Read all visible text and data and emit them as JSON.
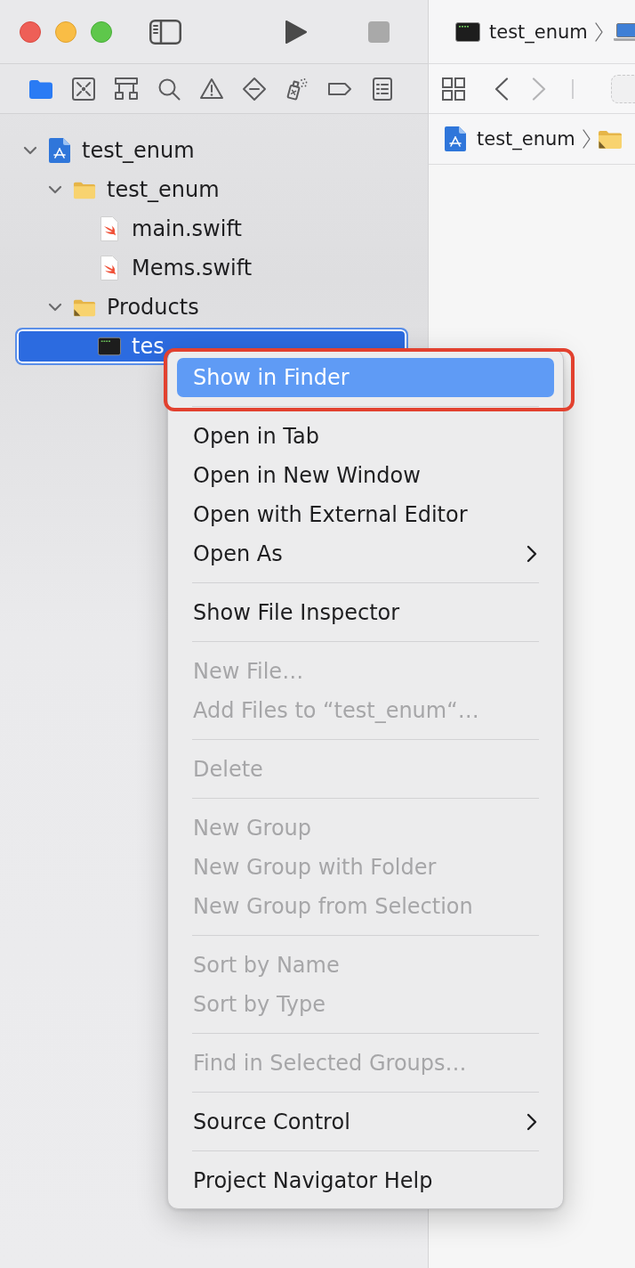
{
  "toolbar": {
    "run_buttons": [
      {
        "kind": "run",
        "disabled": false
      },
      {
        "kind": "stop",
        "disabled": true
      }
    ],
    "scheme": "test_enum"
  },
  "navigator_tabs": [
    {
      "kind": "project",
      "selected": true
    },
    {
      "kind": "source_control",
      "selected": false
    },
    {
      "kind": "symbol",
      "selected": false
    },
    {
      "kind": "find",
      "selected": false
    },
    {
      "kind": "issue",
      "selected": false
    },
    {
      "kind": "test",
      "selected": false
    },
    {
      "kind": "debug",
      "selected": false
    },
    {
      "kind": "breakpoint",
      "selected": false
    },
    {
      "kind": "report",
      "selected": false
    }
  ],
  "editor_nav": {
    "buttons": [
      {
        "kind": "grid"
      },
      {
        "kind": "back",
        "disabled": false
      },
      {
        "kind": "forward",
        "disabled": true
      }
    ]
  },
  "jump_bar": [
    {
      "kind": "project",
      "label": "test_enum"
    },
    {
      "kind": "products_folder"
    }
  ],
  "tree": [
    {
      "kind": "project",
      "label": "test_enum",
      "expanded": true,
      "selected": false,
      "children": [
        {
          "kind": "folder",
          "label": "test_enum",
          "expanded": true,
          "selected": false,
          "children": [
            {
              "kind": "swift",
              "label": "main.swift",
              "selected": false
            },
            {
              "kind": "swift",
              "label": "Mems.swift",
              "selected": false
            }
          ]
        },
        {
          "kind": "products_folder",
          "label": "Products",
          "expanded": true,
          "selected": false,
          "children": [
            {
              "kind": "executable",
              "label": "tes",
              "selected": true
            }
          ]
        }
      ]
    }
  ],
  "context_menu": {
    "sections": [
      {
        "items": [
          {
            "label": "Show in Finder",
            "selected": true,
            "disabled": false,
            "submenu": false,
            "outlined": true
          }
        ]
      },
      {
        "items": [
          {
            "label": "Open in Tab",
            "selected": false,
            "disabled": false,
            "submenu": false,
            "outlined": false
          },
          {
            "label": "Open in New Window",
            "selected": false,
            "disabled": false,
            "submenu": false,
            "outlined": false
          },
          {
            "label": "Open with External Editor",
            "selected": false,
            "disabled": false,
            "submenu": false,
            "outlined": false
          },
          {
            "label": "Open As",
            "selected": false,
            "disabled": false,
            "submenu": true,
            "outlined": false
          }
        ]
      },
      {
        "items": [
          {
            "label": "Show File Inspector",
            "selected": false,
            "disabled": false,
            "submenu": false,
            "outlined": false
          }
        ]
      },
      {
        "items": [
          {
            "label": "New File…",
            "selected": false,
            "disabled": true,
            "submenu": false,
            "outlined": false
          },
          {
            "label": "Add Files to “test_enum“…",
            "selected": false,
            "disabled": true,
            "submenu": false,
            "outlined": false
          }
        ]
      },
      {
        "items": [
          {
            "label": "Delete",
            "selected": false,
            "disabled": true,
            "submenu": false,
            "outlined": false
          }
        ]
      },
      {
        "items": [
          {
            "label": "New Group",
            "selected": false,
            "disabled": true,
            "submenu": false,
            "outlined": false
          },
          {
            "label": "New Group with Folder",
            "selected": false,
            "disabled": true,
            "submenu": false,
            "outlined": false
          },
          {
            "label": "New Group from Selection",
            "selected": false,
            "disabled": true,
            "submenu": false,
            "outlined": false
          }
        ]
      },
      {
        "items": [
          {
            "label": "Sort by Name",
            "selected": false,
            "disabled": true,
            "submenu": false,
            "outlined": false
          },
          {
            "label": "Sort by Type",
            "selected": false,
            "disabled": true,
            "submenu": false,
            "outlined": false
          }
        ]
      },
      {
        "items": [
          {
            "label": "Find in Selected Groups…",
            "selected": false,
            "disabled": true,
            "submenu": false,
            "outlined": false
          }
        ]
      },
      {
        "items": [
          {
            "label": "Source Control",
            "selected": false,
            "disabled": false,
            "submenu": true,
            "outlined": false
          }
        ]
      },
      {
        "items": [
          {
            "label": "Project Navigator Help",
            "selected": false,
            "disabled": false,
            "submenu": false,
            "outlined": false
          }
        ]
      }
    ]
  }
}
